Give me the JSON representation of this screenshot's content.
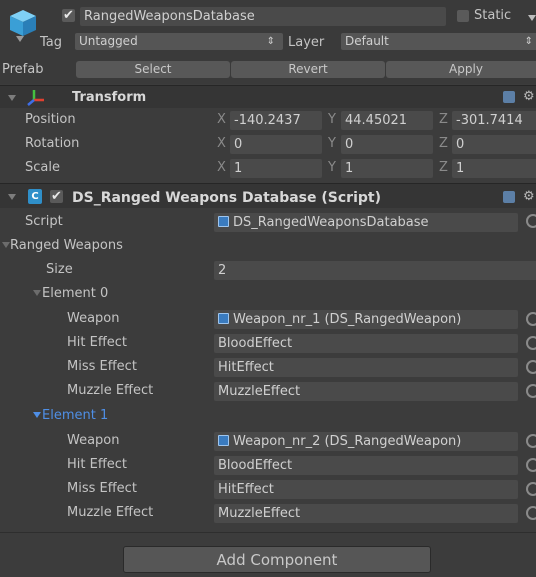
{
  "header": {
    "object_name": "RangedWeaponsDatabase",
    "active": true,
    "static_label": "Static",
    "tag_label": "Tag",
    "tag_value": "Untagged",
    "layer_label": "Layer",
    "layer_value": "Default",
    "prefab_label": "Prefab",
    "prefab_buttons": [
      "Select",
      "Revert",
      "Apply"
    ]
  },
  "transform": {
    "title": "Transform",
    "rows": [
      {
        "label": "Position",
        "x": "-140.2437",
        "y": "44.45021",
        "z": "-301.7414"
      },
      {
        "label": "Rotation",
        "x": "0",
        "y": "0",
        "z": "0"
      },
      {
        "label": "Scale",
        "x": "1",
        "y": "1",
        "z": "1"
      }
    ],
    "axis": [
      "X",
      "Y",
      "Z"
    ]
  },
  "script": {
    "title": "DS_Ranged Weapons Database (Script)",
    "enabled": true,
    "script_label": "Script",
    "script_value": "DS_RangedWeaponsDatabase",
    "ranged_weapons_label": "Ranged Weapons",
    "size_label": "Size",
    "size_value": "2",
    "elements": [
      {
        "label": "Element 0",
        "selected": false,
        "fields": [
          {
            "label": "Weapon",
            "value": "Weapon_nr_1 (DS_RangedWeapon)",
            "ref": true
          },
          {
            "label": "Hit Effect",
            "value": "BloodEffect",
            "ref": false
          },
          {
            "label": "Miss Effect",
            "value": "HitEffect",
            "ref": false
          },
          {
            "label": "Muzzle Effect",
            "value": "MuzzleEffect",
            "ref": false
          }
        ]
      },
      {
        "label": "Element 1",
        "selected": true,
        "fields": [
          {
            "label": "Weapon",
            "value": "Weapon_nr_2 (DS_RangedWeapon)",
            "ref": true
          },
          {
            "label": "Hit Effect",
            "value": "BloodEffect",
            "ref": false
          },
          {
            "label": "Miss Effect",
            "value": "HitEffect",
            "ref": false
          },
          {
            "label": "Muzzle Effect",
            "value": "MuzzleEffect",
            "ref": false
          }
        ]
      }
    ]
  },
  "footer": {
    "add_component_label": "Add Component"
  },
  "colors": {
    "selected_text": "#4f8fe6",
    "panel_bg": "#3c3c3c",
    "field_bg": "#4a4a4a"
  }
}
